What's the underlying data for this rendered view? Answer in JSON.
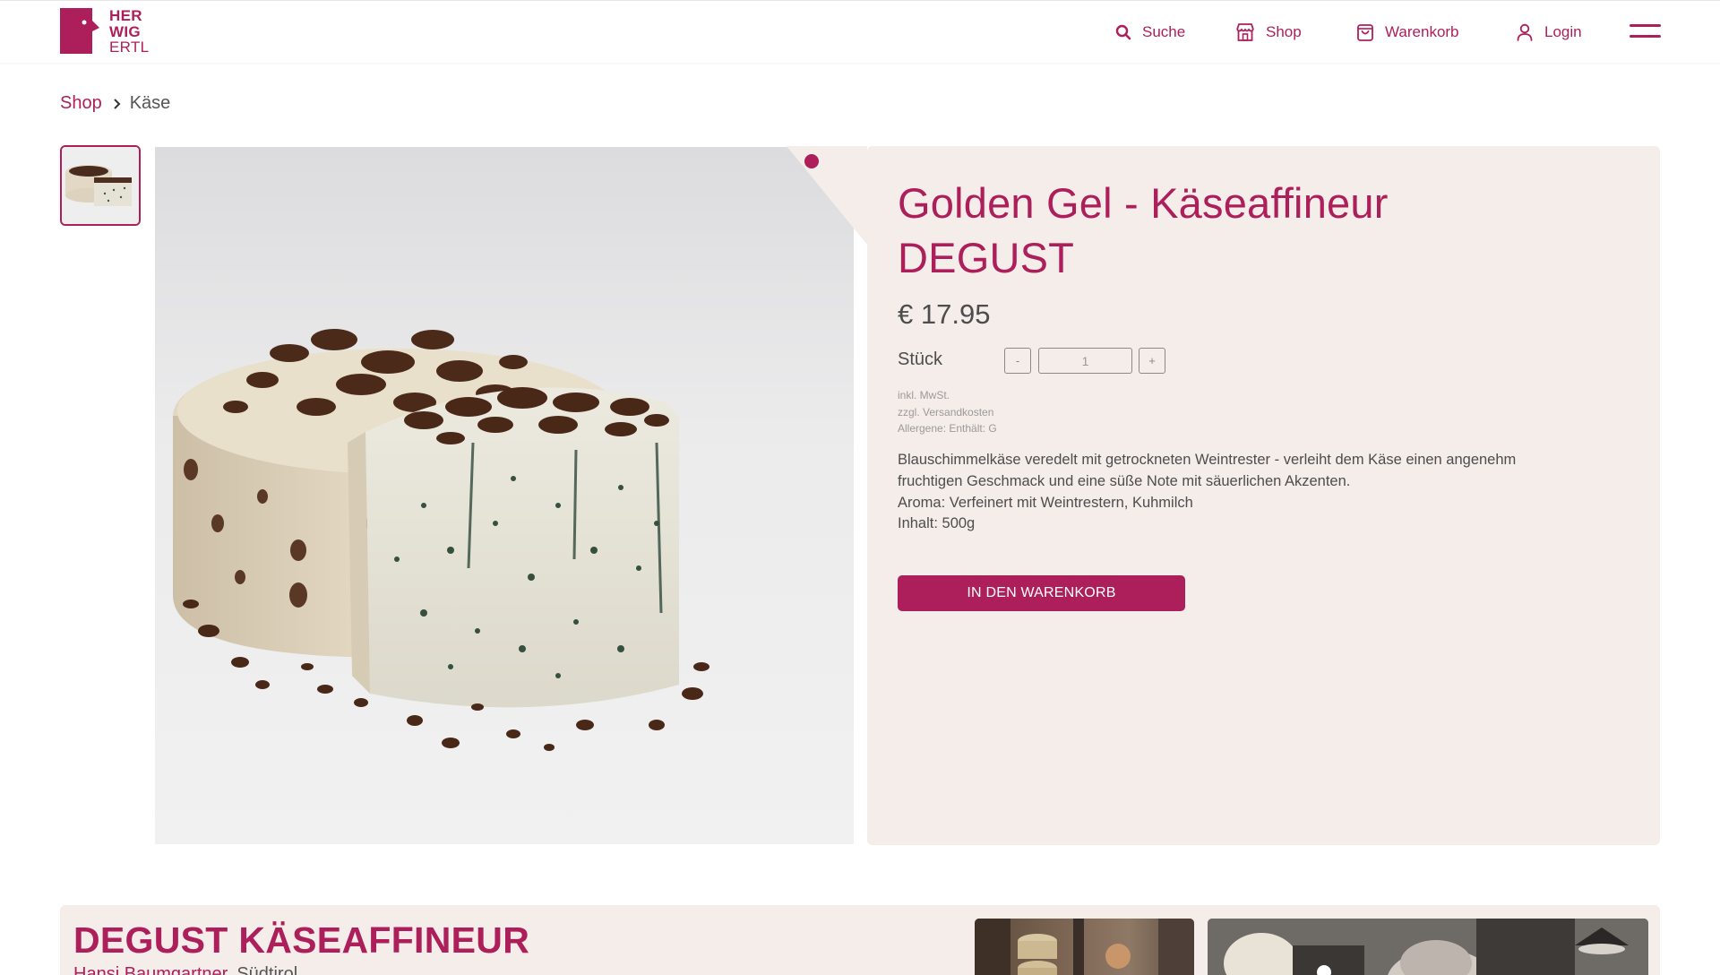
{
  "header": {
    "logo": {
      "line1": "HER",
      "line2": "WIG",
      "line3": "ERTL"
    },
    "nav": {
      "search": "Suche",
      "shop": "Shop",
      "cart": "Warenkorb",
      "login": "Login"
    }
  },
  "breadcrumb": {
    "link": "Shop",
    "current": "Käse"
  },
  "product": {
    "title": "Golden Gel - Käseaffineur DEGUST",
    "price": "€ 17.95",
    "quantity_label": "Stück",
    "quantity_value": "1",
    "minus_label": "-",
    "plus_label": "+",
    "info": {
      "vat": "inkl. MwSt.",
      "shipping": "zzgl. Versandkosten",
      "allergens": "Allergene: Enthält: G"
    },
    "description": {
      "line1": "Blauschimmelkäse veredelt mit getrockneten Weintrester - verleiht dem Käse einen angenehm fruchtigen Geschmack und eine süße Note mit säuerlichen Akzenten.",
      "line2": "Aroma: Verfeinert mit Weintrestern, Kuhmilch",
      "line3": "Inhalt: 500g"
    },
    "add_to_cart": "IN DEN WARENKORB"
  },
  "producer": {
    "title": "DEGUST KÄSEAFFINEUR",
    "name": "Hansi Baumgartner",
    "location": "Südtirol"
  },
  "colors": {
    "brand": "#ad1f5a",
    "panel": "#f5ede9"
  },
  "icons": {
    "search": "search-icon",
    "shop": "store-icon",
    "cart": "shopping-bag-icon",
    "login": "user-icon",
    "menu": "hamburger-menu-icon",
    "breadcrumb_separator": "chevron-right-icon"
  }
}
